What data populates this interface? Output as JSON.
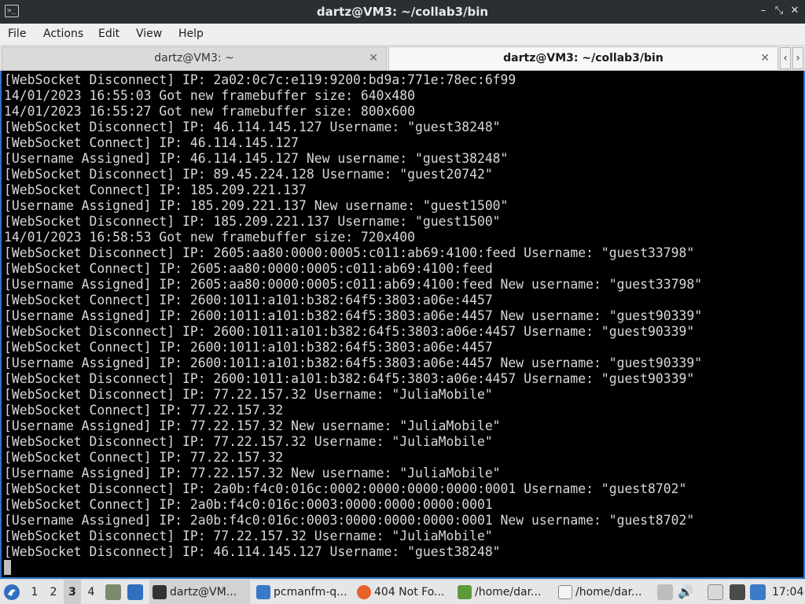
{
  "window": {
    "title": "dartz@VM3: ~/collab3/bin",
    "controls": {
      "minimize": "–",
      "maximize": "⤡",
      "close": "✕"
    }
  },
  "menu": [
    "File",
    "Actions",
    "Edit",
    "View",
    "Help"
  ],
  "tabs": [
    {
      "label": "dartz@VM3: ~",
      "active": false
    },
    {
      "label": "dartz@VM3: ~/collab3/bin",
      "active": true
    }
  ],
  "tab_nav": {
    "prev": "‹",
    "next": "›"
  },
  "terminal_lines": [
    "[WebSocket Disconnect] IP: 2a02:0c7c:e119:9200:bd9a:771e:78ec:6f99",
    "14/01/2023 16:55:03 Got new framebuffer size: 640x480",
    "14/01/2023 16:55:27 Got new framebuffer size: 800x600",
    "[WebSocket Disconnect] IP: 46.114.145.127 Username: \"guest38248\"",
    "[WebSocket Connect] IP: 46.114.145.127",
    "[Username Assigned] IP: 46.114.145.127 New username: \"guest38248\"",
    "[WebSocket Disconnect] IP: 89.45.224.128 Username: \"guest20742\"",
    "[WebSocket Connect] IP: 185.209.221.137",
    "[Username Assigned] IP: 185.209.221.137 New username: \"guest1500\"",
    "[WebSocket Disconnect] IP: 185.209.221.137 Username: \"guest1500\"",
    "14/01/2023 16:58:53 Got new framebuffer size: 720x400",
    "[WebSocket Disconnect] IP: 2605:aa80:0000:0005:c011:ab69:4100:feed Username: \"guest33798\"",
    "[WebSocket Connect] IP: 2605:aa80:0000:0005:c011:ab69:4100:feed",
    "[Username Assigned] IP: 2605:aa80:0000:0005:c011:ab69:4100:feed New username: \"guest33798\"",
    "[WebSocket Connect] IP: 2600:1011:a101:b382:64f5:3803:a06e:4457",
    "[Username Assigned] IP: 2600:1011:a101:b382:64f5:3803:a06e:4457 New username: \"guest90339\"",
    "[WebSocket Disconnect] IP: 2600:1011:a101:b382:64f5:3803:a06e:4457 Username: \"guest90339\"",
    "[WebSocket Connect] IP: 2600:1011:a101:b382:64f5:3803:a06e:4457",
    "[Username Assigned] IP: 2600:1011:a101:b382:64f5:3803:a06e:4457 New username: \"guest90339\"",
    "[WebSocket Disconnect] IP: 2600:1011:a101:b382:64f5:3803:a06e:4457 Username: \"guest90339\"",
    "[WebSocket Disconnect] IP: 77.22.157.32 Username: \"JuliaMobile\"",
    "[WebSocket Connect] IP: 77.22.157.32",
    "[Username Assigned] IP: 77.22.157.32 New username: \"JuliaMobile\"",
    "[WebSocket Disconnect] IP: 77.22.157.32 Username: \"JuliaMobile\"",
    "[WebSocket Connect] IP: 77.22.157.32",
    "[Username Assigned] IP: 77.22.157.32 New username: \"JuliaMobile\"",
    "[WebSocket Disconnect] IP: 2a0b:f4c0:016c:0002:0000:0000:0000:0001 Username: \"guest8702\"",
    "[WebSocket Connect] IP: 2a0b:f4c0:016c:0003:0000:0000:0000:0001",
    "[Username Assigned] IP: 2a0b:f4c0:016c:0003:0000:0000:0000:0001 New username: \"guest8702\"",
    "[WebSocket Disconnect] IP: 77.22.157.32 Username: \"JuliaMobile\"",
    "[WebSocket Disconnect] IP: 46.114.145.127 Username: \"guest38248\""
  ],
  "taskbar": {
    "workspaces": [
      "1",
      "2",
      "3",
      "4"
    ],
    "active_workspace": "3",
    "tasks": [
      {
        "label": "dartz@VM...",
        "icon": "terminal-icon"
      },
      {
        "label": "pcmanfm-q...",
        "icon": "folder-icon"
      },
      {
        "label": "404 Not Fo...",
        "icon": "firefox-icon"
      },
      {
        "label": "/home/dar...",
        "icon": "text-file-icon"
      },
      {
        "label": "/home/dar...",
        "icon": "text-editor-icon"
      }
    ],
    "clock": "17:04"
  },
  "colors": {
    "terminal_bg": "#000000",
    "terminal_fg": "#d8d8d8",
    "accent_border": "#2a74c7",
    "titlebar_bg": "#2a2f33"
  }
}
